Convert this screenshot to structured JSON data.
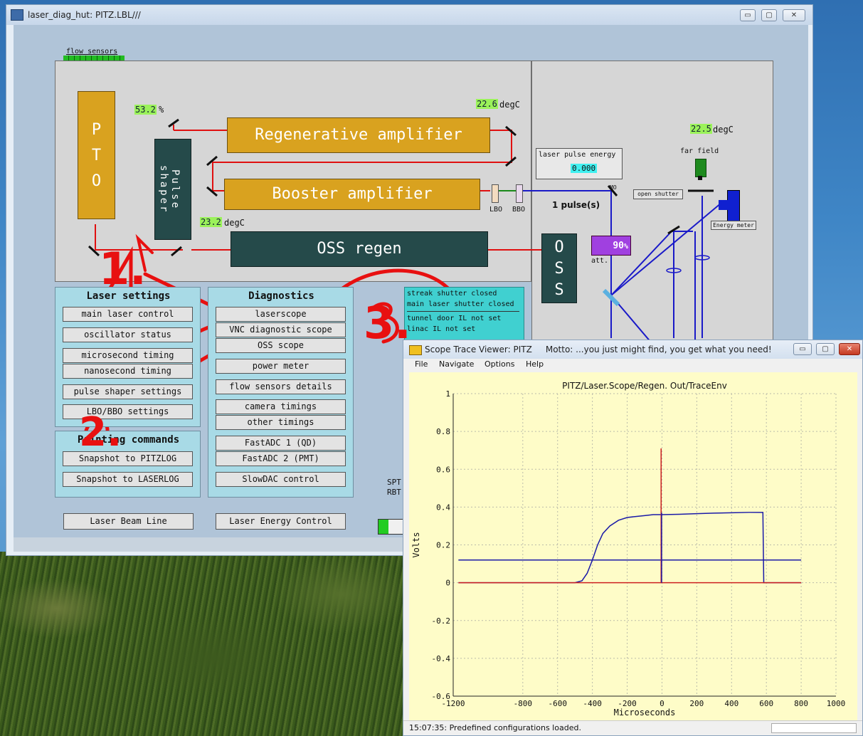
{
  "main_window": {
    "title": "laser_diag_hut: PITZ.LBL///",
    "controls": [
      "▭",
      "▢",
      "✕"
    ],
    "flow_sensors_label": "flow sensors",
    "pto_letters": [
      "P",
      "T",
      "O"
    ],
    "pulse_shaper_text": "Pulse shaper",
    "regen_label": "Regenerative amplifier",
    "booster_label": "Booster amplifier",
    "oss_regen_label": "OSS regen",
    "oss_letters": [
      "O",
      "S",
      "S"
    ],
    "pct_value": "53.2",
    "pct_unit": "%",
    "temp1_value": "22.6",
    "temp1_unit": "degC",
    "temp2_value": "22.5",
    "temp2_unit": "degC",
    "temp3_value": "23.2",
    "temp3_unit": "degC",
    "lbo_label": "LBO",
    "bbo_label": "BBO",
    "mo_label": "MO",
    "pulses_label": "1 pulse(s)",
    "laser_pulse_energy_label": "laser pulse energy",
    "laser_pulse_energy_value": "0.000",
    "far_field_label": "far field",
    "open_shutter_label": "open shutter",
    "energy_meter_label": "Energy meter",
    "att_value": "90",
    "att_unit": "%",
    "att_label": "att.",
    "status_lines": [
      "streak shutter closed",
      "main laser shutter closed",
      "tunnel door IL not set",
      "linac IL not set"
    ],
    "spt_labels": [
      "SPT",
      "RBT"
    ],
    "laser_settings": {
      "title": "Laser settings",
      "buttons": [
        "main laser control",
        "oscillator status",
        "microsecond timing",
        "nanosecond timing",
        "pulse shaper settings",
        "LBO/BBO settings"
      ]
    },
    "printing": {
      "title": "Printing commands",
      "buttons": [
        "Snapshot to PITZLOG",
        "Snapshot to LASERLOG"
      ]
    },
    "diagnostics": {
      "title": "Diagnostics",
      "buttons": [
        "laserscope",
        "VNC diagnostic scope",
        "OSS scope",
        "power meter",
        "flow sensors details",
        "camera timings",
        "other timings",
        "FastADC 1 (QD)",
        "FastADC 2 (PMT)",
        "SlowDAC control"
      ]
    },
    "bottom_buttons": [
      "Laser Beam Line",
      "Laser Energy Control"
    ],
    "annotations": [
      "1.",
      "2.",
      "3."
    ]
  },
  "scope_window": {
    "title": "Scope Trace Viewer: PITZ     Motto: ...you just might find, you get what you need!",
    "menu": [
      "File",
      "Navigate",
      "Options",
      "Help"
    ],
    "status": "15:07:35: Predefined configurations loaded.",
    "chart_data": {
      "type": "line",
      "title": "PITZ/Laser.Scope/Regen. Out/TraceEnv",
      "xlabel": "Microseconds",
      "ylabel": "Volts",
      "xlim": [
        -1200,
        1000
      ],
      "ylim": [
        -0.6,
        1
      ],
      "xticks": [
        -1200,
        -800,
        -600,
        -400,
        -200,
        0,
        200,
        400,
        600,
        800,
        1000
      ],
      "yticks": [
        -0.6,
        -0.4,
        -0.2,
        0,
        0.2,
        0.4,
        0.6,
        0.8,
        1
      ],
      "grid": true,
      "series": [
        {
          "color": "#1a1aa8",
          "x": [
            -1170,
            -500,
            -460,
            -430,
            -400,
            -370,
            -340,
            -300,
            -250,
            -200,
            -150,
            -100,
            -50,
            0,
            100,
            200,
            300,
            400,
            500,
            580,
            585,
            800
          ],
          "y": [
            0,
            0,
            0.01,
            0.05,
            0.12,
            0.2,
            0.26,
            0.3,
            0.33,
            0.345,
            0.35,
            0.355,
            0.36,
            0.36,
            0.362,
            0.365,
            0.368,
            0.37,
            0.372,
            0.372,
            0,
            0
          ]
        },
        {
          "color": "#1a1aa8",
          "x": [
            -1170,
            800
          ],
          "y": [
            0.12,
            0.12
          ]
        },
        {
          "color": "#cc2020",
          "x": [
            -1170,
            800
          ],
          "y": [
            0,
            0
          ]
        },
        {
          "color": "#cc2020",
          "x": [
            -5,
            -5
          ],
          "y": [
            0,
            0.71
          ]
        },
        {
          "color": "#1a1aa8",
          "x": [
            -2,
            -2
          ],
          "y": [
            0,
            0.37
          ]
        }
      ]
    }
  },
  "colors": {
    "beam_red": "#e01010",
    "beam_blue": "#1a1ac8",
    "annotation_red": "#e81010",
    "orange_box": "#d9a21f",
    "dark_box": "#254a4a",
    "value_green": "#9bf25a",
    "value_cyan": "#40f0f0",
    "group_blue": "#a8dae6",
    "status_cyan": "#40d0d0",
    "att_purple": "#a040e0"
  }
}
